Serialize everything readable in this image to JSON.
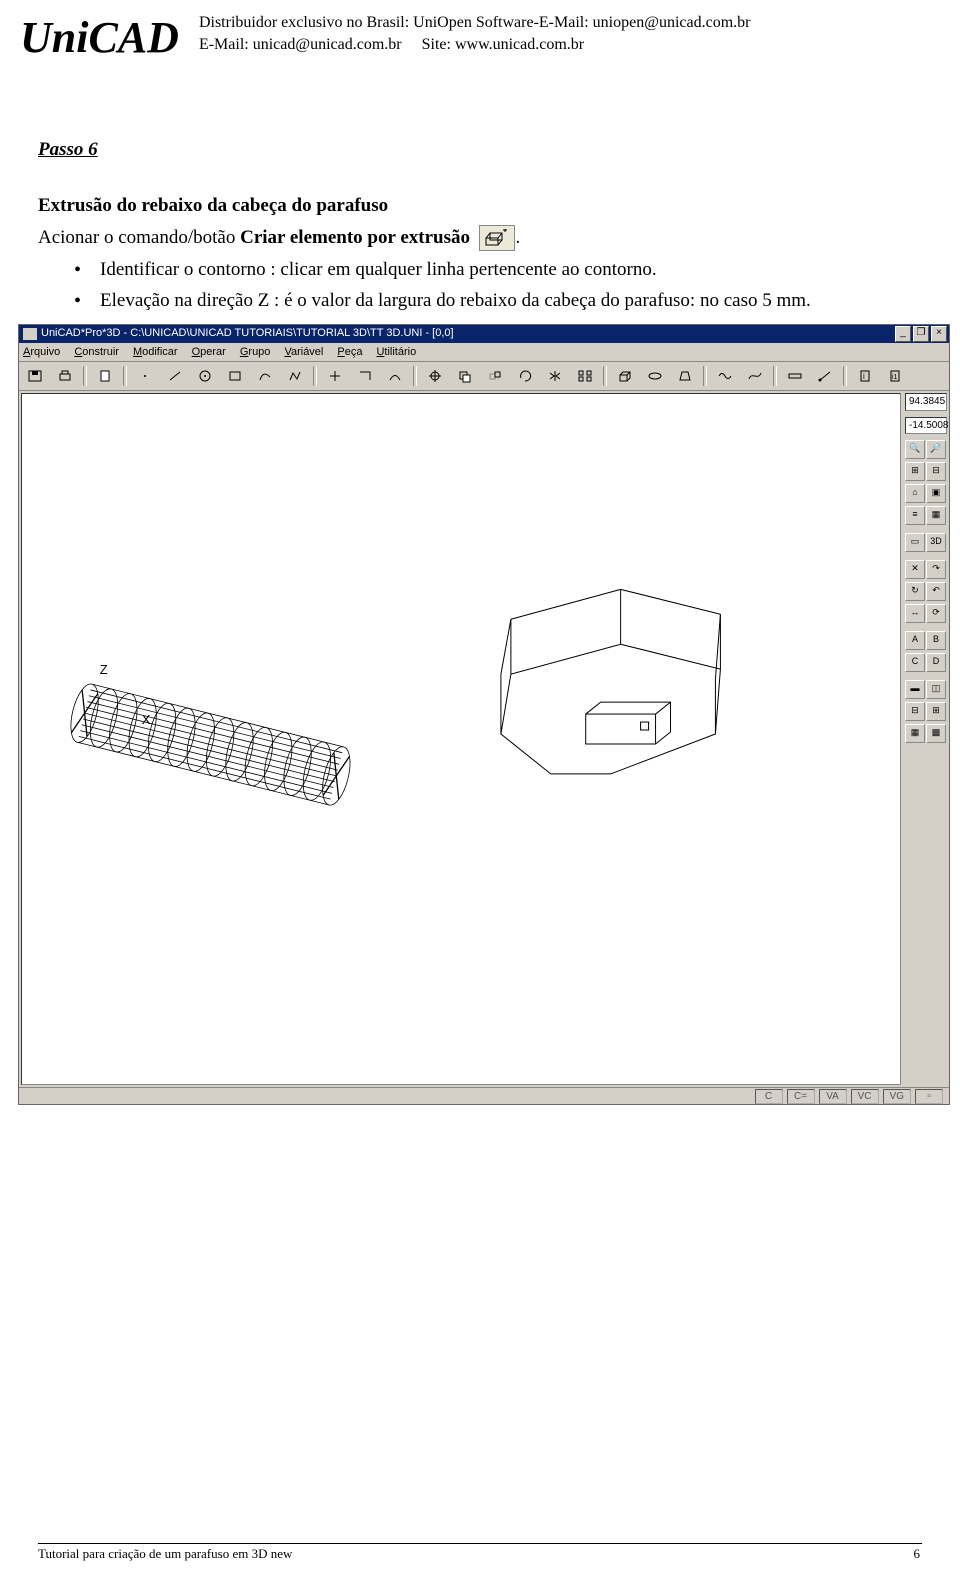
{
  "header": {
    "logo": "UniCAD",
    "line1": "Distribuidor exclusivo no Brasil: UniOpen Software-E-Mail: uniopen@unicad.com.br",
    "line2_a": "E-Mail: unicad@unicad.com.br",
    "line2_b": "Site: www.unicad.com.br"
  },
  "step_label": "Passo 6",
  "heading": "Extrusão do rebaixo da cabeça do parafuso",
  "line_pre": "Acionar o comando/botão ",
  "line_bold": "Criar elemento por extrusão",
  "line_post": ".",
  "bullets": [
    "Identificar o contorno : clicar em qualquer linha pertencente ao contorno.",
    "Elevação na direção Z : é o valor da largura do rebaixo da cabeça do parafuso: no caso 5 mm."
  ],
  "app": {
    "title": "UniCAD*Pro*3D - C:\\UNICAD\\UNICAD TUTORIAIS\\TUTORIAL 3D\\TT 3D.UNI - [0,0]",
    "menu": [
      "Arquivo",
      "Construir",
      "Modificar",
      "Operar",
      "Grupo",
      "Variável",
      "Peça",
      "Utilitário"
    ],
    "coords": {
      "x": "94.3845",
      "y": "-14.5008"
    },
    "right_labels": {
      "d3": "3D",
      "a": "A",
      "b": "B",
      "c": "C",
      "d": "D"
    },
    "status": [
      "C",
      "C=",
      "VA",
      "VC",
      "VG"
    ],
    "axis_z": "Z",
    "axis_x": "X"
  },
  "footer": {
    "left": "Tutorial para criação de um parafuso em 3D new",
    "right": "6"
  }
}
